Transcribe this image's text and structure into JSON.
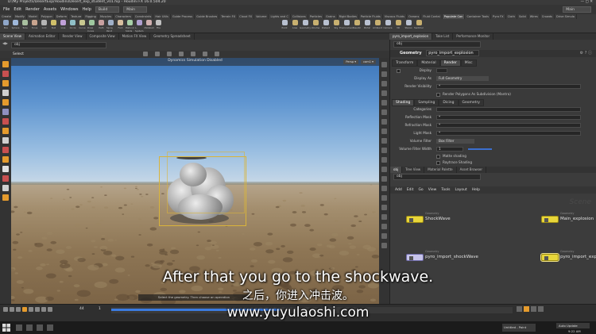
{
  "window": {
    "title": "D:/My Projects/DesertExp/Houdini/Desert_exp_student_v01.hip - Houdini FX 16.0.504.20"
  },
  "menu": [
    "File",
    "Edit",
    "Render",
    "Assets",
    "Windows",
    "Help"
  ],
  "desktop": {
    "left": "Build",
    "center": "Main",
    "right": "Main"
  },
  "shelf": {
    "tabs": [
      "Create",
      "Modify",
      "Model",
      "Polygon",
      "Deform",
      "Texture",
      "Rigging",
      "Muscles",
      "Characters",
      "Constraints",
      "Hair Utils",
      "Guide Process",
      "Guide Brushes",
      "Terrain FX",
      "Cloud FX",
      "Volume",
      "Lights and C",
      "Collisions",
      "Particles",
      "Grains",
      "Rigid Bodies",
      "Particle Fluids",
      "Viscous Fluids",
      "Oceans",
      "Fluid Contai",
      "Populate Con",
      "Container Tools",
      "Pyro FX",
      "Cloth",
      "Solid",
      "Wires",
      "Crowds",
      "Drive Simula"
    ],
    "active_tab": "Populate Con",
    "tools": [
      "Box",
      "Sphere",
      "Tube",
      "Torus",
      "Grid",
      "Null",
      "Line",
      "Circle",
      "Curve",
      "Draw Curve",
      "Path",
      "Spray Paint",
      "Font",
      "Platonic Solids",
      "L-System",
      "Metaball",
      "File"
    ],
    "right_tools": [
      "Point Light",
      "Area Light",
      "Geometry Light",
      "Volume Light",
      "Distant Light",
      "Sky Light",
      "Environment Light",
      "Caustic Light",
      "Portal Light",
      "Ambient Light",
      "Camera",
      "VR Camera",
      "Stereo Camera",
      "Switcher"
    ]
  },
  "viewport_tabs": [
    "Scene View",
    "Animation Editor",
    "Render View",
    "Composite View",
    "Motion FX View",
    "Geometry Spreadsheet"
  ],
  "param_tabs": [
    "pyro_import_explosion",
    "Take List",
    "Performance Monitor"
  ],
  "viewport": {
    "path": "obj",
    "select_label": "Select",
    "status": "Dynamics Simulation Disabled",
    "persp": "Persp ▾",
    "cam": "cam1 ▾",
    "hint": "Select the geometry. Then choose an operation"
  },
  "parameters": {
    "path": "obj",
    "node_type": "Geometry",
    "node_name": "pyro_import_explosion",
    "top_tabs": [
      "Transform",
      "Material",
      "Render",
      "Misc"
    ],
    "sub_tabs": [
      "Shading",
      "Sampling",
      "Dicing",
      "Geometry"
    ],
    "display_label": "Display",
    "display_as_label": "Display As",
    "display_as_value": "Full Geometry",
    "render_visibility_label": "Render Visibility",
    "render_visibility_value": "*",
    "render_polygons_label": "Render Polygons As Subdivision (Mantra)",
    "categories_label": "Categories",
    "reflection_mask_label": "Reflection Mask",
    "reflection_mask_value": "*",
    "refraction_mask_label": "Refraction Mask",
    "refraction_mask_value": "*",
    "light_mask_label": "Light Mask",
    "light_mask_value": "*",
    "volume_filter_label": "Volume Filter",
    "volume_filter_value": "Box Filter",
    "volume_filter_width_label": "Volume Filter Width",
    "volume_filter_width_value": "1",
    "matte_shading_label": "Matte shading",
    "raytrace_shading_label": "Raytrace Shading"
  },
  "network": {
    "tabs": [
      "obj",
      "Tree View",
      "Material Palette",
      "Asset Browser"
    ],
    "path": "obj",
    "menu": [
      "Add",
      "Edit",
      "Go",
      "View",
      "Tools",
      "Layout",
      "Help"
    ],
    "watermark": "Scene",
    "nodes": [
      {
        "name": "ShockWave",
        "type": "Geometry",
        "color": "yellow"
      },
      {
        "name": "Main_explosion",
        "type": "Geometry",
        "color": "yellow"
      },
      {
        "name": "pyro_import_shockWave",
        "type": "Geometry",
        "color": "blue"
      },
      {
        "name": "pyro_import_explosion",
        "type": "Geometry",
        "color": "yellow"
      }
    ]
  },
  "timeline": {
    "frame": "44",
    "start": "1",
    "progress": 0.42,
    "auto_update": "Auto Update"
  },
  "subtitles": {
    "english": "After that you go to the shockwave.",
    "chinese": "之后，你进入冲击波。",
    "url": "www.yuyulaoshi.com"
  },
  "taskbar": {
    "window_label": "Untitled - Paint",
    "auto_update": "Auto Update",
    "time": "9:22 AM"
  },
  "colors": {
    "accent": "#e59b2d",
    "node_yellow": "#e8d63a",
    "node_blue": "#c7c4ea",
    "bbox": "#d9b43a"
  }
}
